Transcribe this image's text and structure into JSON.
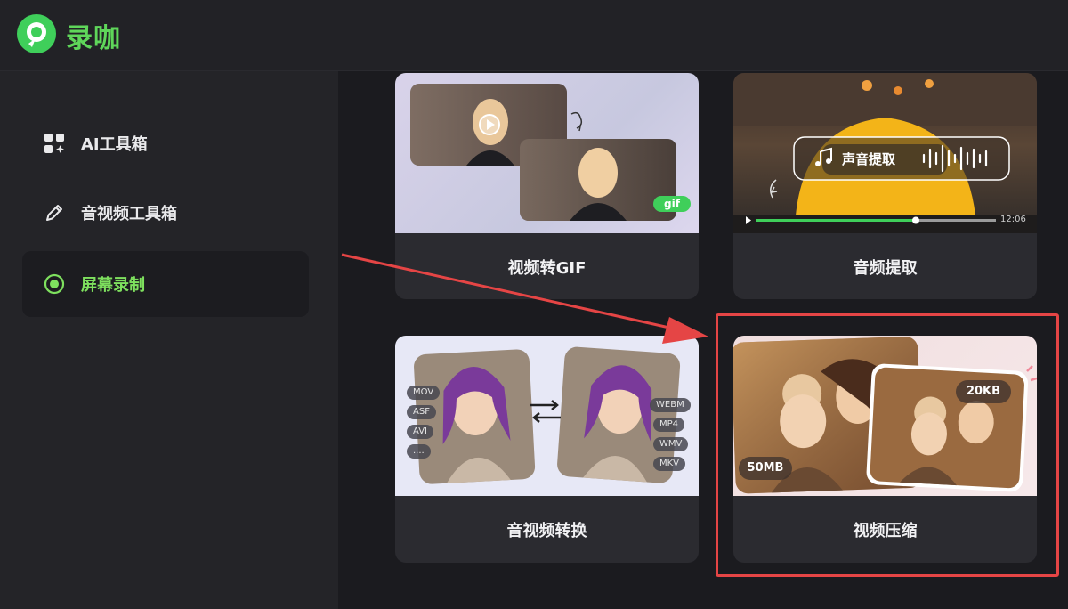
{
  "app": {
    "name": "录咖"
  },
  "sidebar": {
    "items": [
      {
        "label": "AI工具箱",
        "icon": "apps-grid-icon",
        "active": false
      },
      {
        "label": "音视频工具箱",
        "icon": "pencil-icon",
        "active": false
      },
      {
        "label": "屏幕录制",
        "icon": "record-dot-icon",
        "active": true
      }
    ]
  },
  "cards": [
    {
      "label": "视频转GIF",
      "badge": "gif"
    },
    {
      "label": "音频提取",
      "overlay": "声音提取",
      "time": "12:06"
    },
    {
      "label": "音视频转换",
      "formats_left": [
        "MOV",
        "ASF",
        "AVI",
        "...."
      ],
      "formats_right": [
        "WEBM",
        "MP4",
        "WMV",
        "MKV"
      ]
    },
    {
      "label": "视频压缩",
      "size_before": "50MB",
      "size_after": "20KB"
    }
  ],
  "colors": {
    "accent": "#5fd65a",
    "highlight": "#e54545",
    "background": "#1b1b1f",
    "card": "#2b2b30"
  }
}
